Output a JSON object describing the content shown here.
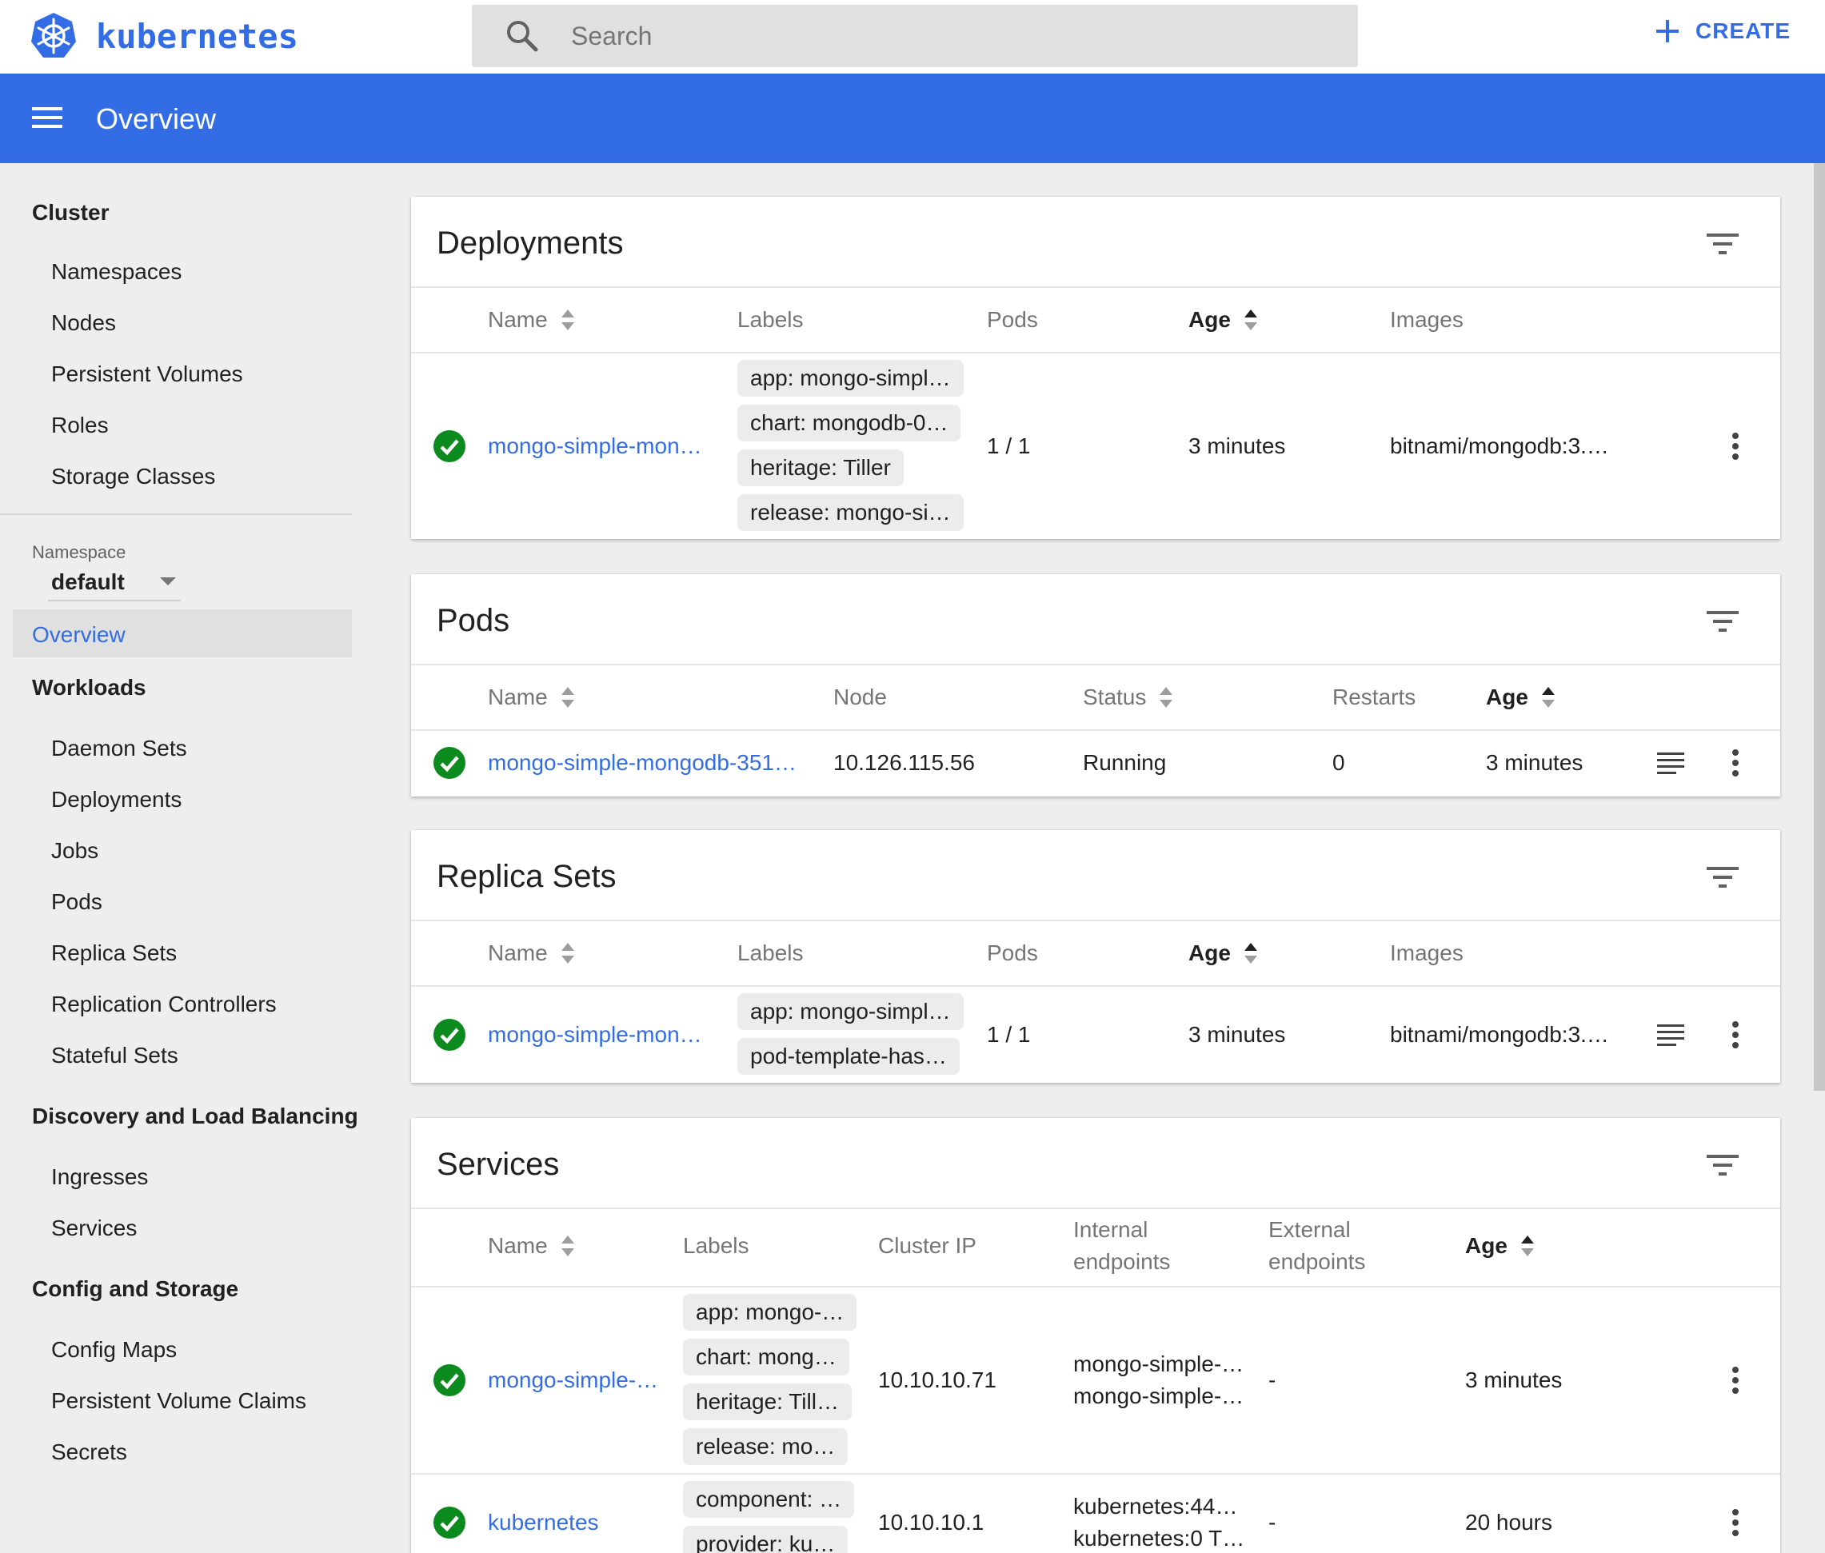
{
  "app": {
    "name": "kubernetes",
    "brand_color": "#326de6"
  },
  "search": {
    "placeholder": "Search"
  },
  "create": {
    "label": "CREATE"
  },
  "appbar": {
    "title": "Overview"
  },
  "sidebar": {
    "cluster": {
      "title": "Cluster",
      "items": [
        "Namespaces",
        "Nodes",
        "Persistent Volumes",
        "Roles",
        "Storage Classes"
      ]
    },
    "namespace": {
      "label": "Namespace",
      "value": "default"
    },
    "overview": "Overview",
    "workloads": {
      "title": "Workloads",
      "items": [
        "Daemon Sets",
        "Deployments",
        "Jobs",
        "Pods",
        "Replica Sets",
        "Replication Controllers",
        "Stateful Sets"
      ]
    },
    "discovery": {
      "title": "Discovery and Load Balancing",
      "items": [
        "Ingresses",
        "Services"
      ]
    },
    "config": {
      "title": "Config and Storage",
      "items": [
        "Config Maps",
        "Persistent Volume Claims",
        "Secrets"
      ]
    }
  },
  "deployments": {
    "title": "Deployments",
    "headers": {
      "name": "Name",
      "labels": "Labels",
      "pods": "Pods",
      "age": "Age",
      "images": "Images"
    },
    "rows": [
      {
        "status": "ok",
        "name": "mongo-simple-mon…",
        "labels": [
          "app: mongo-simpl…",
          "chart: mongodb-0…",
          "heritage: Tiller",
          "release: mongo-si…"
        ],
        "pods": "1 / 1",
        "age": "3 minutes",
        "images": "bitnami/mongodb:3.…"
      }
    ]
  },
  "pods": {
    "title": "Pods",
    "headers": {
      "name": "Name",
      "node": "Node",
      "status": "Status",
      "restarts": "Restarts",
      "age": "Age"
    },
    "rows": [
      {
        "status_icon": "ok",
        "name": "mongo-simple-mongodb-351…",
        "node": "10.126.115.56",
        "status": "Running",
        "restarts": "0",
        "age": "3 minutes"
      }
    ]
  },
  "replica_sets": {
    "title": "Replica Sets",
    "headers": {
      "name": "Name",
      "labels": "Labels",
      "pods": "Pods",
      "age": "Age",
      "images": "Images"
    },
    "rows": [
      {
        "status": "ok",
        "name": "mongo-simple-mon…",
        "labels": [
          "app: mongo-simpl…",
          "pod-template-has…"
        ],
        "pods": "1 / 1",
        "age": "3 minutes",
        "images": "bitnami/mongodb:3.…"
      }
    ]
  },
  "services": {
    "title": "Services",
    "headers": {
      "name": "Name",
      "labels": "Labels",
      "cluster_ip": "Cluster IP",
      "internal_1": "Internal",
      "internal_2": "endpoints",
      "external_1": "External",
      "external_2": "endpoints",
      "age": "Age"
    },
    "rows": [
      {
        "status": "ok",
        "name": "mongo-simple-…",
        "labels": [
          "app: mongo-…",
          "chart: mong…",
          "heritage: Till…",
          "release: mo…"
        ],
        "cluster_ip": "10.10.10.71",
        "internal": [
          "mongo-simple-…",
          "mongo-simple-…"
        ],
        "external": "-",
        "age": "3 minutes"
      },
      {
        "status": "ok",
        "name": "kubernetes",
        "labels": [
          "component: …",
          "provider: ku…"
        ],
        "cluster_ip": "10.10.10.1",
        "internal": [
          "kubernetes:44…",
          "kubernetes:0 T…"
        ],
        "external": "-",
        "age": "20 hours"
      }
    ]
  },
  "colors": {
    "ok": "#0b8a1d",
    "link": "#326de6",
    "appbar": "#326de6"
  }
}
